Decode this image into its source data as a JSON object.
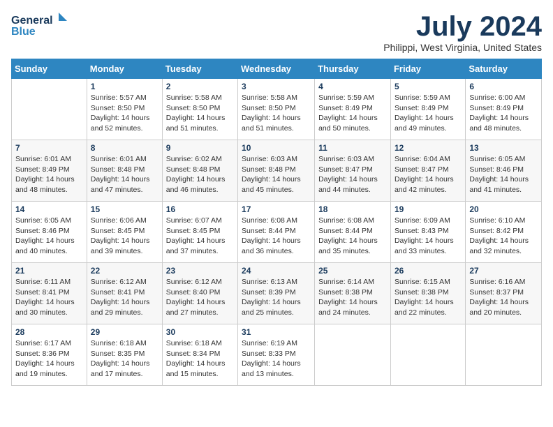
{
  "header": {
    "logo_line1": "General",
    "logo_line2": "Blue",
    "title": "July 2024",
    "subtitle": "Philippi, West Virginia, United States"
  },
  "columns": [
    "Sunday",
    "Monday",
    "Tuesday",
    "Wednesday",
    "Thursday",
    "Friday",
    "Saturday"
  ],
  "weeks": [
    [
      {
        "day": "",
        "info": ""
      },
      {
        "day": "1",
        "info": "Sunrise: 5:57 AM\nSunset: 8:50 PM\nDaylight: 14 hours\nand 52 minutes."
      },
      {
        "day": "2",
        "info": "Sunrise: 5:58 AM\nSunset: 8:50 PM\nDaylight: 14 hours\nand 51 minutes."
      },
      {
        "day": "3",
        "info": "Sunrise: 5:58 AM\nSunset: 8:50 PM\nDaylight: 14 hours\nand 51 minutes."
      },
      {
        "day": "4",
        "info": "Sunrise: 5:59 AM\nSunset: 8:49 PM\nDaylight: 14 hours\nand 50 minutes."
      },
      {
        "day": "5",
        "info": "Sunrise: 5:59 AM\nSunset: 8:49 PM\nDaylight: 14 hours\nand 49 minutes."
      },
      {
        "day": "6",
        "info": "Sunrise: 6:00 AM\nSunset: 8:49 PM\nDaylight: 14 hours\nand 48 minutes."
      }
    ],
    [
      {
        "day": "7",
        "info": "Sunrise: 6:01 AM\nSunset: 8:49 PM\nDaylight: 14 hours\nand 48 minutes."
      },
      {
        "day": "8",
        "info": "Sunrise: 6:01 AM\nSunset: 8:48 PM\nDaylight: 14 hours\nand 47 minutes."
      },
      {
        "day": "9",
        "info": "Sunrise: 6:02 AM\nSunset: 8:48 PM\nDaylight: 14 hours\nand 46 minutes."
      },
      {
        "day": "10",
        "info": "Sunrise: 6:03 AM\nSunset: 8:48 PM\nDaylight: 14 hours\nand 45 minutes."
      },
      {
        "day": "11",
        "info": "Sunrise: 6:03 AM\nSunset: 8:47 PM\nDaylight: 14 hours\nand 44 minutes."
      },
      {
        "day": "12",
        "info": "Sunrise: 6:04 AM\nSunset: 8:47 PM\nDaylight: 14 hours\nand 42 minutes."
      },
      {
        "day": "13",
        "info": "Sunrise: 6:05 AM\nSunset: 8:46 PM\nDaylight: 14 hours\nand 41 minutes."
      }
    ],
    [
      {
        "day": "14",
        "info": "Sunrise: 6:05 AM\nSunset: 8:46 PM\nDaylight: 14 hours\nand 40 minutes."
      },
      {
        "day": "15",
        "info": "Sunrise: 6:06 AM\nSunset: 8:45 PM\nDaylight: 14 hours\nand 39 minutes."
      },
      {
        "day": "16",
        "info": "Sunrise: 6:07 AM\nSunset: 8:45 PM\nDaylight: 14 hours\nand 37 minutes."
      },
      {
        "day": "17",
        "info": "Sunrise: 6:08 AM\nSunset: 8:44 PM\nDaylight: 14 hours\nand 36 minutes."
      },
      {
        "day": "18",
        "info": "Sunrise: 6:08 AM\nSunset: 8:44 PM\nDaylight: 14 hours\nand 35 minutes."
      },
      {
        "day": "19",
        "info": "Sunrise: 6:09 AM\nSunset: 8:43 PM\nDaylight: 14 hours\nand 33 minutes."
      },
      {
        "day": "20",
        "info": "Sunrise: 6:10 AM\nSunset: 8:42 PM\nDaylight: 14 hours\nand 32 minutes."
      }
    ],
    [
      {
        "day": "21",
        "info": "Sunrise: 6:11 AM\nSunset: 8:41 PM\nDaylight: 14 hours\nand 30 minutes."
      },
      {
        "day": "22",
        "info": "Sunrise: 6:12 AM\nSunset: 8:41 PM\nDaylight: 14 hours\nand 29 minutes."
      },
      {
        "day": "23",
        "info": "Sunrise: 6:12 AM\nSunset: 8:40 PM\nDaylight: 14 hours\nand 27 minutes."
      },
      {
        "day": "24",
        "info": "Sunrise: 6:13 AM\nSunset: 8:39 PM\nDaylight: 14 hours\nand 25 minutes."
      },
      {
        "day": "25",
        "info": "Sunrise: 6:14 AM\nSunset: 8:38 PM\nDaylight: 14 hours\nand 24 minutes."
      },
      {
        "day": "26",
        "info": "Sunrise: 6:15 AM\nSunset: 8:38 PM\nDaylight: 14 hours\nand 22 minutes."
      },
      {
        "day": "27",
        "info": "Sunrise: 6:16 AM\nSunset: 8:37 PM\nDaylight: 14 hours\nand 20 minutes."
      }
    ],
    [
      {
        "day": "28",
        "info": "Sunrise: 6:17 AM\nSunset: 8:36 PM\nDaylight: 14 hours\nand 19 minutes."
      },
      {
        "day": "29",
        "info": "Sunrise: 6:18 AM\nSunset: 8:35 PM\nDaylight: 14 hours\nand 17 minutes."
      },
      {
        "day": "30",
        "info": "Sunrise: 6:18 AM\nSunset: 8:34 PM\nDaylight: 14 hours\nand 15 minutes."
      },
      {
        "day": "31",
        "info": "Sunrise: 6:19 AM\nSunset: 8:33 PM\nDaylight: 14 hours\nand 13 minutes."
      },
      {
        "day": "",
        "info": ""
      },
      {
        "day": "",
        "info": ""
      },
      {
        "day": "",
        "info": ""
      }
    ]
  ]
}
